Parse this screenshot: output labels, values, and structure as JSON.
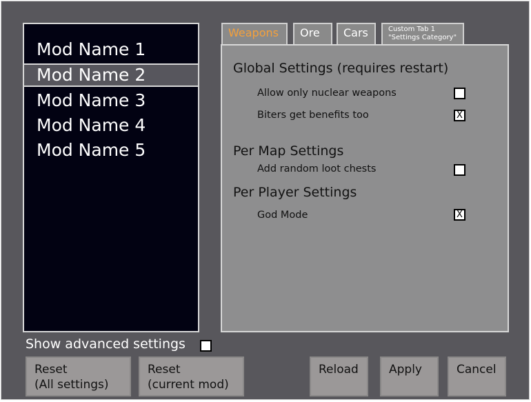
{
  "mod_list": {
    "items": [
      {
        "label": "Mod Name 1",
        "selected": false
      },
      {
        "label": "Mod Name 2",
        "selected": true
      },
      {
        "label": "Mod Name 3",
        "selected": false
      },
      {
        "label": "Mod Name 4",
        "selected": false
      },
      {
        "label": "Mod Name 5",
        "selected": false
      }
    ]
  },
  "tabs": [
    {
      "label": "Weapons",
      "active": true
    },
    {
      "label": "Ore",
      "active": false
    },
    {
      "label": "Cars",
      "active": false
    },
    {
      "line1": "Custom Tab 1",
      "line2": "\"Settings Category\"",
      "active": false
    }
  ],
  "colors": {
    "active_tab_text": "#f5a03a"
  },
  "settings": {
    "global": {
      "title": "Global Settings (requires restart)",
      "options": [
        {
          "label": "Allow only nuclear weapons",
          "checked": false,
          "mark": ""
        },
        {
          "label": "Biters get benefits too",
          "checked": true,
          "mark": "X"
        }
      ]
    },
    "per_map": {
      "title": "Per Map Settings",
      "options": [
        {
          "label": "Add random loot chests",
          "checked": false,
          "mark": ""
        }
      ]
    },
    "per_player": {
      "title": "Per Player Settings",
      "options": [
        {
          "label": "God Mode",
          "checked": true,
          "mark": "X"
        }
      ]
    }
  },
  "advanced": {
    "label": "Show advanced settings",
    "checked": false
  },
  "buttons": {
    "reset_all": {
      "line1": "Reset",
      "line2": "(All settings)"
    },
    "reset_mod": {
      "line1": "Reset",
      "line2": "(current mod)"
    },
    "reload": "Reload",
    "apply": "Apply",
    "cancel": "Cancel"
  }
}
